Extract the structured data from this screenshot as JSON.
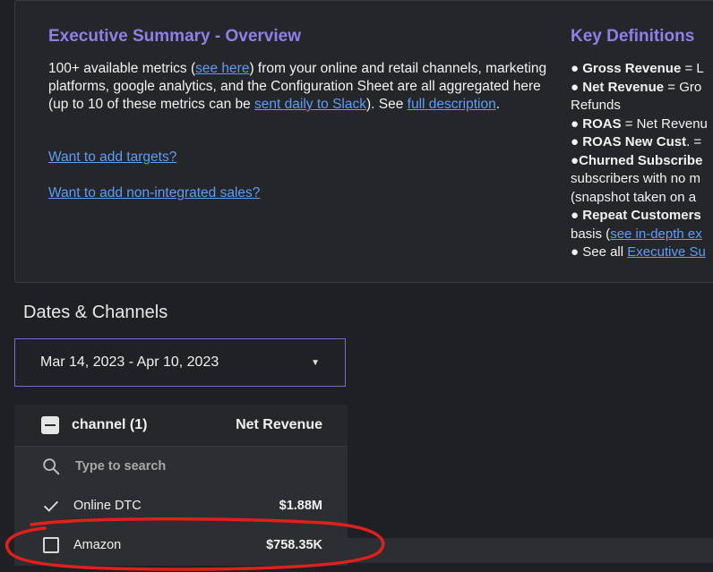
{
  "summary": {
    "title": "Executive Summary - Overview",
    "p1": "100+ available metrics (",
    "link_see_here": "see here",
    "p2": ") from your online and retail channels, marketing platforms, google analytics, and the Configuration Sheet are all aggregated here (up to 10 of these metrics can be ",
    "link_slack": "sent daily to Slack",
    "p3": "). See ",
    "link_full": "full description",
    "p4": ".",
    "link_targets": "Want to add targets?",
    "link_nonintegrated": "Want to add non-integrated sales?"
  },
  "definitions": {
    "title": "Key Definitions",
    "gross_term": "Gross Revenue",
    "gross_rest": " = L",
    "net_term": "Net Revenue",
    "net_rest": " = Gro",
    "refunds": "Refunds",
    "roas_term": "ROAS",
    "roas_rest": " = Net Revenu",
    "roasnew_term": "ROAS New Cust",
    "roasnew_rest": ". =",
    "churned_term": "Churned Subscribe",
    "churned_line2": "subscribers with no m",
    "churned_line3": "(snapshot taken on a",
    "repeat_term": "Repeat Customers",
    "basis_pre": "basis (",
    "link_indepth": "see in-depth ex",
    "seeall_pre": "See all ",
    "link_exec": "Executive Su"
  },
  "section": {
    "title": "Dates & Channels"
  },
  "date_range": {
    "value": "Mar 14, 2023 - Apr 10, 2023"
  },
  "channel_table": {
    "header_label": "channel (1)",
    "metric_label": "Net Revenue",
    "search_placeholder": "Type to search",
    "rows": [
      {
        "label": "Online DTC",
        "value": "$1.88M",
        "checked": true
      },
      {
        "label": "Amazon",
        "value": "$758.35K",
        "checked": false
      }
    ]
  },
  "colors": {
    "accent_purple": "#8f7fe8",
    "link_blue": "#5f9cf7",
    "annotation_red": "#e0201c",
    "background": "#1f2023"
  }
}
